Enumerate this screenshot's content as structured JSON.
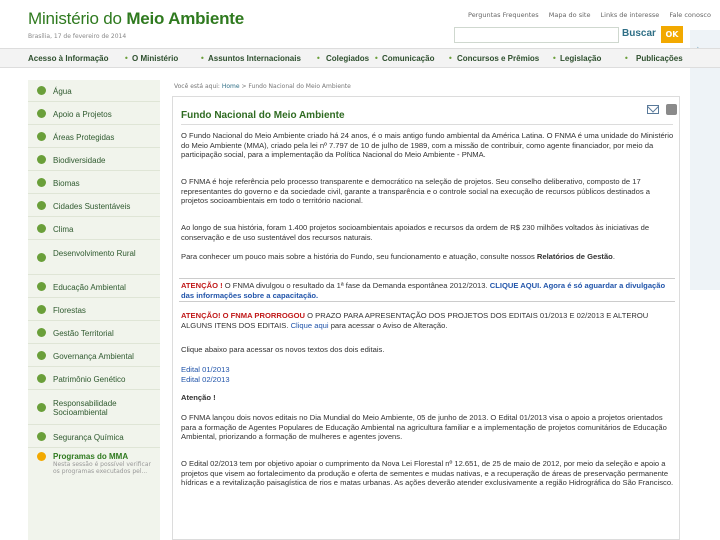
{
  "header": {
    "logo_prefix": "Ministério do",
    "logo_bold": "Meio Ambiente",
    "date": "Brasília, 17 de fevereiro de 2014",
    "top_links": [
      "Perguntas Frequentes",
      "Mapa do site",
      "Links de interesse",
      "Fale conosco"
    ],
    "search_label": "Buscar",
    "search_button": "OK"
  },
  "nav": {
    "items": [
      "Acesso à Informação",
      "O Ministério",
      "Assuntos Internacionais",
      "Colegiados",
      "Comunicação",
      "Concursos e Prêmios",
      "Legislação",
      "Publicações"
    ]
  },
  "sidebar": {
    "items": [
      "Água",
      "Apoio a Projetos",
      "Áreas Protegidas",
      "Biodiversidade",
      "Biomas",
      "Cidades Sustentáveis",
      "Clima",
      "Desenvolvimento Rural",
      "Educação Ambiental",
      "Florestas",
      "Gestão Territorial",
      "Governança Ambiental",
      "Patrimônio Genético",
      "Responsabilidade Socioambiental",
      "Segurança Química",
      "Programas do MMA"
    ],
    "sub_text": "Nesta sessão é possível verificar os programas executados pel..."
  },
  "content": {
    "breadcrumb_prefix": "Você está aqui:",
    "breadcrumb_home": "Home",
    "breadcrumb_sep": " > ",
    "breadcrumb_current": "Fundo Nacional do Meio Ambiente",
    "title": "Fundo Nacional do Meio Ambiente",
    "p1": "O Fundo Nacional do Meio Ambiente criado há 24 anos, é o mais antigo fundo ambiental da América Latina. O FNMA é uma unidade do Ministério do Meio Ambiente (MMA), criado pela lei nº 7.797 de 10 de julho de 1989, com a missão de contribuir, como agente financiador, por meio da participação social, para a implementação da Política Nacional do Meio Ambiente - PNMA.",
    "p2": "O FNMA é hoje referência pelo processo transparente e democrático na seleção de projetos. Seu conselho deliberativo, composto de 17 representantes do governo e da sociedade civil, garante a transparência e o controle social na execução de recursos públicos destinados a projetos socioambientais em todo o território nacional.",
    "p3": "Ao longo de sua história, foram 1.400 projetos socioambientais apoiados e recursos da ordem de R$ 230 milhões voltados às iniciativas de conservação e de uso sustentável dos recursos naturais.",
    "p4_text": "Para conhecer um pouco mais sobre a história do Fundo, seu funcionamento e atuação, consulte nossos ",
    "p4_bold": "Relatórios de Gestão",
    "p4_end": ".",
    "n1_red": "ATENÇÃO !",
    "n1_text": " O FNMA divulgou o resultado da 1ª fase da Demanda espontânea 2012/2013. ",
    "n1_link": "CLIQUE AQUI.",
    "n1_tail": " Agora é só aguardar a divulgação das informações sobre a capacitação.",
    "n2_red": "ATENÇÃO! O FNMA PRORROGOU",
    "n2_text": " O PRAZO PARA APRESENTAÇÃO DOS PROJETOS DOS EDITAIS 01/2013 E 02/2013 E ALTEROU ALGUNS ITENS DOS EDITAIS. ",
    "n2_link": "Clique aqui",
    "n2_tail": " para acessar o Aviso de Alteração.",
    "p5": "Clique abaixo para acessar os novos textos dos dois editais.",
    "edital1": "Edital 01/2013",
    "edital2": "Edital 02/2013",
    "atencao": "Atenção !",
    "p6": "O FNMA lançou dois novos editais no Dia Mundial do Meio Ambiente, 05 de junho de 2013. O Edital 01/2013 visa o apoio a projetos orientados para a formação de Agentes Populares de Educação Ambiental na agricultura familiar e a implementação de projetos comunitários de Educação Ambiental, priorizando a formação de mulheres e agentes jovens.",
    "p7": "O Edital 02/2013 tem por objetivo apoiar o cumprimento da Nova Lei Florestal nº 12.651, de 25 de maio de 2012, por meio da seleção e apoio a projetos que visem ao fortalecimento da produção e oferta de sementes e mudas nativas, e a recuperação de áreas de preservação permanente hídricas e a revitalização paisagística de rios e matas urbanas. As ações deverão atender exclusivamente a região Hidrográfica do São Francisco."
  }
}
